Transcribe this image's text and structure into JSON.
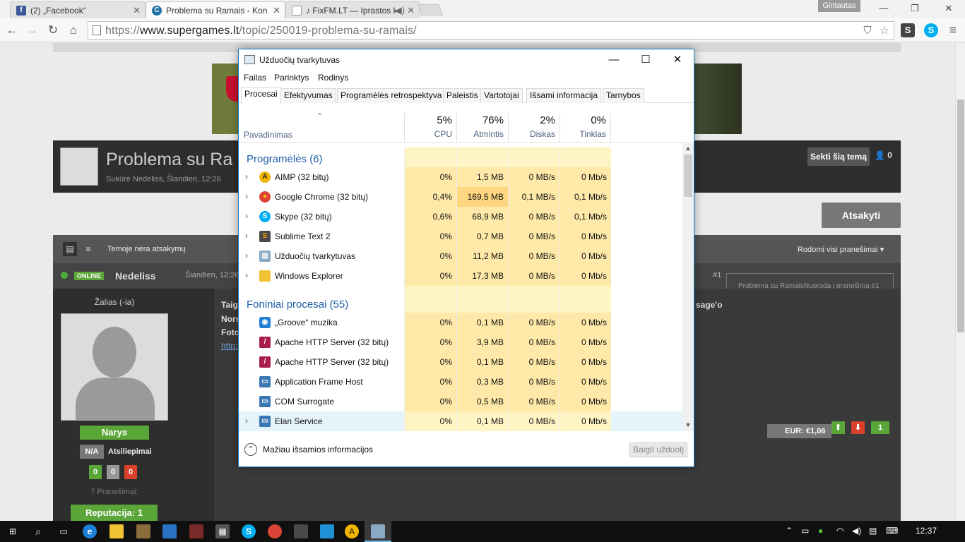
{
  "browser": {
    "tabs": [
      {
        "title": "(2) „Facebook“",
        "icon": "facebook-icon",
        "color": "#3b5998"
      },
      {
        "title": "Problema su Ramais - Kon",
        "icon": "supergames-icon",
        "color": "#1d6fa5"
      },
      {
        "title": "♪ FixFM.LT — Iprastos k",
        "icon": "page-icon",
        "color": "#777777"
      }
    ],
    "user": "Gintautas",
    "url_prefix": "https://",
    "url_host": "www.supergames.lt",
    "url_path": "/topic/250019-problema-su-ramais/"
  },
  "topic": {
    "title": "Problema su Ra",
    "meta": "Sukūrė Nedeliss, Šiandien, 12:26",
    "follow_label": "Sekti šią temą",
    "followers": "0",
    "reply_label": "Atsakyti",
    "no_replies": "Temoje nėra atsakymų",
    "show_all": "Rodomi visi pranešimai",
    "post_number": "#1",
    "post_link_alt": "Problema su RamaisNuoroda į pranešimą #1"
  },
  "post": {
    "online_label": "ONLINE",
    "author": "Nedeliss",
    "date": "Šiandien, 12:26",
    "user_title": "Žalias (-ia)",
    "rank": "Narys",
    "na": "N/A",
    "feedback_label": "Atsiliepimai",
    "counts": [
      "0",
      "0",
      "0"
    ],
    "post_count": "7 Pranešimai:",
    "reputation": "Reputacija: 1",
    "text_lines": [
      "Taig",
      "Nors",
      "Foto",
      "http:"
    ],
    "text_right": "sage'o",
    "eur": "EUR: €1,06",
    "vote_count": "1"
  },
  "taskmanager": {
    "title": "Užduočių tvarkytuvas",
    "menu": [
      "Failas",
      "Parinktys",
      "Rodinys"
    ],
    "tabs": [
      "Procesai",
      "Efektyvumas",
      "Programėlės retrospektyva",
      "Paleistis",
      "Vartotojai",
      "Išsami informacija",
      "Tarnybos"
    ],
    "col_name": "Pavadinimas",
    "columns": [
      {
        "pct": "5%",
        "name": "CPU"
      },
      {
        "pct": "76%",
        "name": "Atmintis"
      },
      {
        "pct": "2%",
        "name": "Diskas"
      },
      {
        "pct": "0%",
        "name": "Tinklas"
      }
    ],
    "groups": {
      "apps": "Programėlės (6)",
      "background": "Foniniai procesai (55)"
    },
    "apps": [
      {
        "name": "AIMP (32 bitų)",
        "icon": "aimp-icon",
        "cpu": "0%",
        "mem": "1,5 MB",
        "disk": "0 MB/s",
        "net": "0 Mb/s"
      },
      {
        "name": "Google Chrome (32 bitų)",
        "icon": "chrome-icon",
        "cpu": "0,4%",
        "mem": "169,5 MB",
        "disk": "0,1 MB/s",
        "net": "0,1 Mb/s"
      },
      {
        "name": "Skype (32 bitų)",
        "icon": "skype-icon",
        "cpu": "0,6%",
        "mem": "68,9 MB",
        "disk": "0 MB/s",
        "net": "0,1 Mb/s"
      },
      {
        "name": "Sublime Text 2",
        "icon": "sublime-icon",
        "cpu": "0%",
        "mem": "0,7 MB",
        "disk": "0 MB/s",
        "net": "0 Mb/s"
      },
      {
        "name": "Užduočių tvarkytuvas",
        "icon": "taskmanager-icon",
        "cpu": "0%",
        "mem": "11,2 MB",
        "disk": "0 MB/s",
        "net": "0 Mb/s"
      },
      {
        "name": "Windows Explorer",
        "icon": "folder-icon",
        "cpu": "0%",
        "mem": "17,3 MB",
        "disk": "0 MB/s",
        "net": "0 Mb/s"
      }
    ],
    "background": [
      {
        "name": "„Groove“ muzika",
        "icon": "groove-icon",
        "cpu": "0%",
        "mem": "0,1 MB",
        "disk": "0 MB/s",
        "net": "0 Mb/s"
      },
      {
        "name": "Apache HTTP Server (32 bitų)",
        "icon": "apache-icon",
        "cpu": "0%",
        "mem": "3,9 MB",
        "disk": "0 MB/s",
        "net": "0 Mb/s"
      },
      {
        "name": "Apache HTTP Server (32 bitų)",
        "icon": "apache-icon",
        "cpu": "0%",
        "mem": "0,1 MB",
        "disk": "0 MB/s",
        "net": "0 Mb/s"
      },
      {
        "name": "Application Frame Host",
        "icon": "window-icon",
        "cpu": "0%",
        "mem": "0,3 MB",
        "disk": "0 MB/s",
        "net": "0 Mb/s"
      },
      {
        "name": "COM Surrogate",
        "icon": "window-icon",
        "cpu": "0%",
        "mem": "0,5 MB",
        "disk": "0 MB/s",
        "net": "0 Mb/s"
      },
      {
        "name": "Elan Service",
        "icon": "window-icon",
        "cpu": "0%",
        "mem": "0,1 MB",
        "disk": "0 MB/s",
        "net": "0 Mb/s"
      }
    ],
    "less_details": "Mažiau išsamios informacijos",
    "end_task": "Baigti užduotį"
  },
  "taskbar": {
    "clock": "12:37"
  },
  "colors": {
    "heat_low": "#fff4c4",
    "heat_mid": "#ffe9a8",
    "heat_high": "#ffd780",
    "accent": "#1e5fa8",
    "green": "#5aa638"
  }
}
